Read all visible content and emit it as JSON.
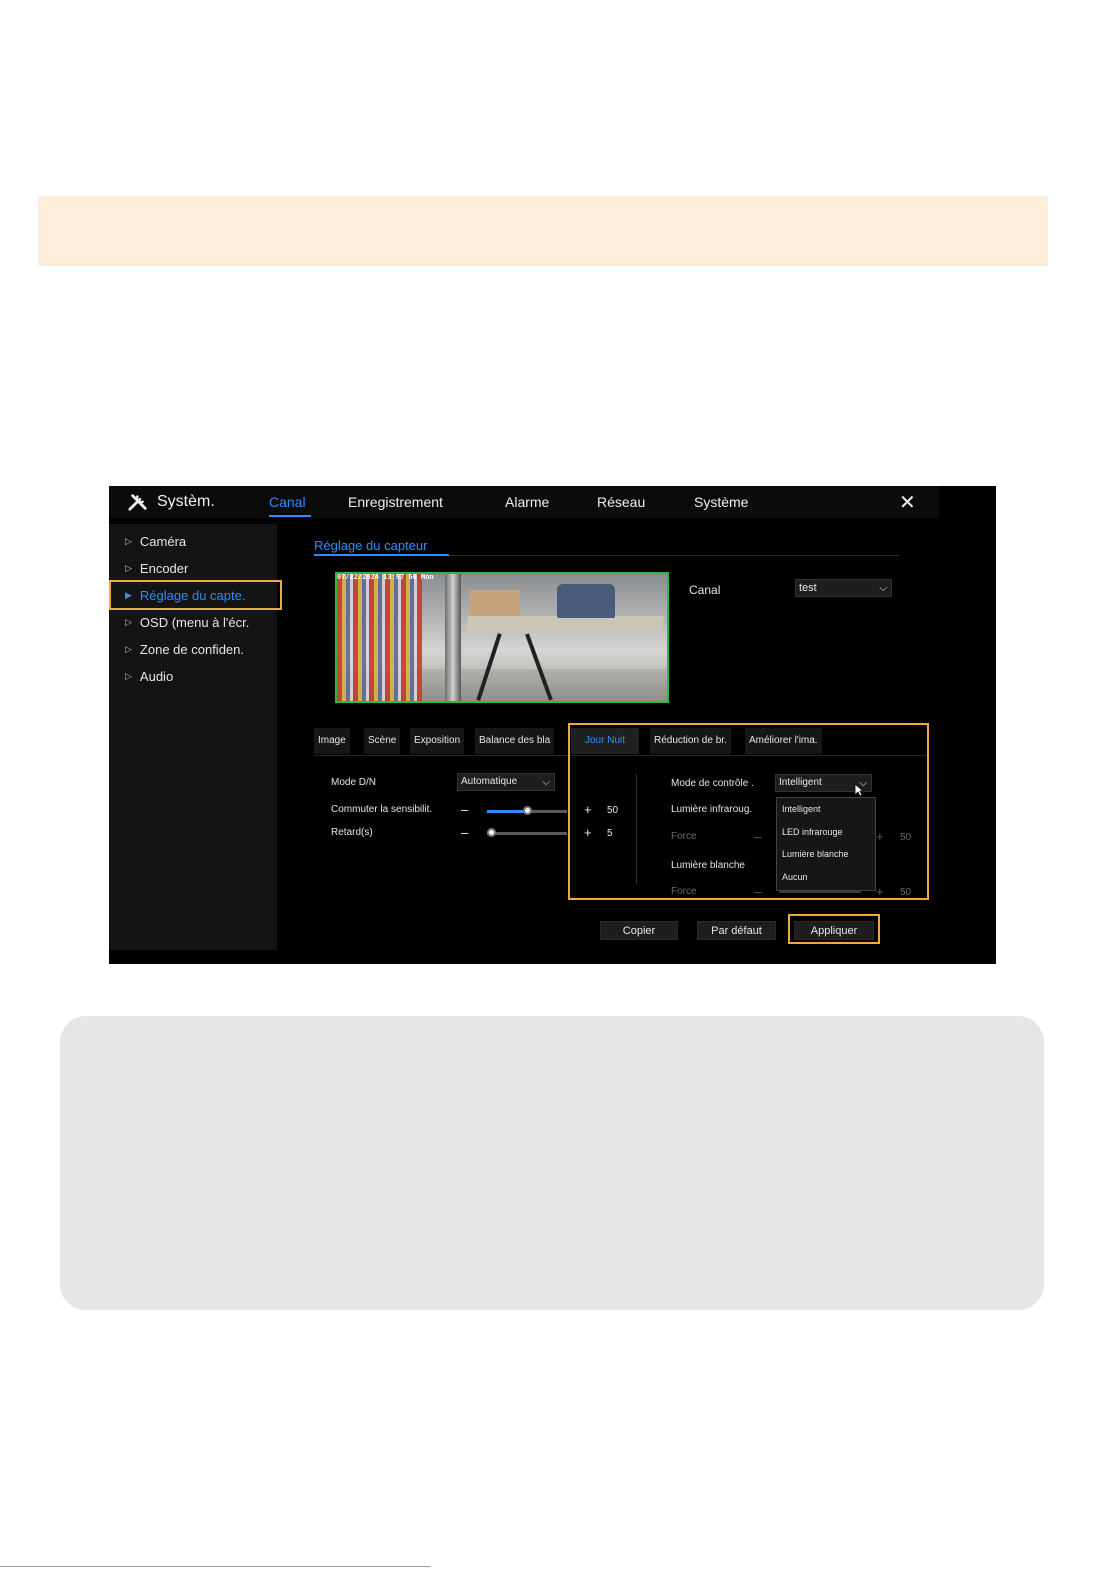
{
  "window": {
    "title": "Systèm.",
    "nav": [
      "Canal",
      "Enregistrement",
      "Alarme",
      "Réseau",
      "Système"
    ],
    "active_nav": "Canal",
    "close": "✕"
  },
  "sidebar": {
    "items": [
      {
        "label": "Caméra"
      },
      {
        "label": "Encoder"
      },
      {
        "label": "Réglage du capte."
      },
      {
        "label": "OSD (menu à l'écr."
      },
      {
        "label": "Zone de confiden."
      },
      {
        "label": "Audio"
      }
    ],
    "active_index": 2
  },
  "section": {
    "title": "Réglage du capteur"
  },
  "preview": {
    "osd_text": "07/22/2024 13:57 56 Mon"
  },
  "canal": {
    "label": "Canal",
    "value": "test"
  },
  "tabs": [
    "Image",
    "Scène",
    "Exposition",
    "Balance des bla",
    "Jour Nuit",
    "Réduction de br.",
    "Améliorer l'ima."
  ],
  "active_tab": "Jour Nuit",
  "left_panel": {
    "mode_label": "Mode D/N",
    "mode_value": "Automatique",
    "sensitivity_label": "Commuter la sensibilit.",
    "sensitivity_value": "50",
    "sensitivity_level": 50,
    "delay_label": "Retard(s)",
    "delay_value": "5",
    "delay_level": 5
  },
  "right_panel": {
    "control_label": "Mode de contrôle .",
    "control_value": "Intelligent",
    "ir_label": "Lumière infraroug.",
    "force_label": "Force",
    "force_value": "50",
    "white_label": "Lumière blanche",
    "force2_label": "Force",
    "force2_value": "50"
  },
  "dropdown": {
    "options": [
      "Intelligent",
      "LED infrarouge",
      "Lumière blanche",
      "Aucun"
    ]
  },
  "buttons": {
    "copy": "Copier",
    "default": "Par défaut",
    "apply": "Appliquer"
  },
  "colors": {
    "accent": "#2f8cff",
    "highlight": "#f0a93a",
    "banner": "#fdeeda",
    "panel": "#e5e6e8"
  }
}
